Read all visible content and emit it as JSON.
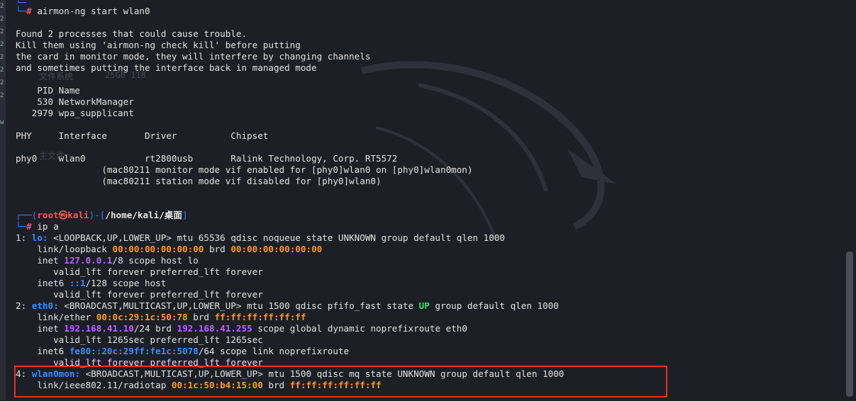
{
  "left_strip": [
    "2",
    "2",
    "2",
    "2",
    "2",
    "2",
    "2",
    "2",
    "w"
  ],
  "ghost_texts": [
    "文件系统",
    "25GB 118",
    "主文件"
  ],
  "terminal": {
    "prompt_prev_top": "└─",
    "cmd1_hash": "#",
    "cmd1": " airmon-ng start wlan0",
    "warn1": "Found 2 processes that could cause trouble.",
    "warn2": "Kill them using 'airmon-ng check kill' before putting",
    "warn3": "the card in monitor mode, they will interfere by changing channels",
    "warn4": "and sometimes putting the interface back in managed mode",
    "pid_header": "    PID Name",
    "pid1": "    530 NetworkManager",
    "pid2": "   2979 wpa_supplicant",
    "phy_header": "PHY     Interface       Driver          Chipset",
    "phy_row": "phy0    wlan0           rt2800usb       Ralink Technology, Corp. RT5572",
    "phy_note1": "                (mac80211 monitor mode vif enabled for [phy0]wlan0 on [phy0]wlan0mon)",
    "phy_note2": "                (mac80211 station mode vif disabled for [phy0]wlan0)",
    "prompt": {
      "open": "┌──(",
      "user": "root",
      "at": "㉿",
      "host": "kali",
      "mid": ")-[",
      "path": "/home/kali/桌面",
      "close": "]"
    },
    "prompt2": "└─",
    "cmd2_hash": "#",
    "cmd2": " ip a",
    "if1": {
      "num": "1: ",
      "name": "lo:",
      "rest": " <LOOPBACK,UP,LOWER_UP> mtu 65536 qdisc noqueue state UNKNOWN group default qlen 1000"
    },
    "lo_link": {
      "pre": "    link/loopback ",
      "mac": "00:00:00:00:00:00",
      "mid": " brd ",
      "brd": "00:00:00:00:00:00"
    },
    "lo_inet": {
      "pre": "    inet ",
      "ip": "127.0.0.1",
      "rest": "/8 scope host lo"
    },
    "lo_valid1": "       valid_lft forever preferred_lft forever",
    "lo_inet6": {
      "pre": "    inet6 ",
      "ip": "::1",
      "rest": "/128 scope host"
    },
    "lo_valid2": "       valid_lft forever preferred_lft forever",
    "if2": {
      "num": "2: ",
      "name": "eth0:",
      "rest1": " <BROADCAST,MULTICAST,UP,LOWER_UP> mtu 1500 qdisc pfifo_fast state ",
      "state": "UP",
      "rest2": " group default qlen 1000"
    },
    "eth_link": {
      "pre": "    link/ether ",
      "mac": "00:0c:29:1c:50:78",
      "mid": " brd ",
      "brd": "ff:ff:ff:ff:ff:ff"
    },
    "eth_inet": {
      "pre": "    inet ",
      "ip": "192.168.41.10",
      "mid": "/24 brd ",
      "brd": "192.168.41.255",
      "rest": " scope global dynamic noprefixroute eth0"
    },
    "eth_valid1": "       valid_lft 1265sec preferred_lft 1265sec",
    "eth_inet6": {
      "pre": "    inet6 ",
      "ip": "fe80::20c:29ff:fe1c:5078",
      "rest": "/64 scope link noprefixroute"
    },
    "eth_valid2": "       valid_lft forever preferred_lft forever",
    "if4": {
      "num": "4: ",
      "name": "wlan0mon:",
      "rest": " <BROADCAST,MULTICAST,UP,LOWER_UP> mtu 1500 qdisc mq state UNKNOWN group default qlen 1000"
    },
    "wlan_link": {
      "pre": "    link/ieee802.11/radiotap ",
      "mac": "00:1c:50:b4:15:00",
      "mid": " brd ",
      "brd": "ff:ff:ff:ff:ff:ff"
    }
  }
}
